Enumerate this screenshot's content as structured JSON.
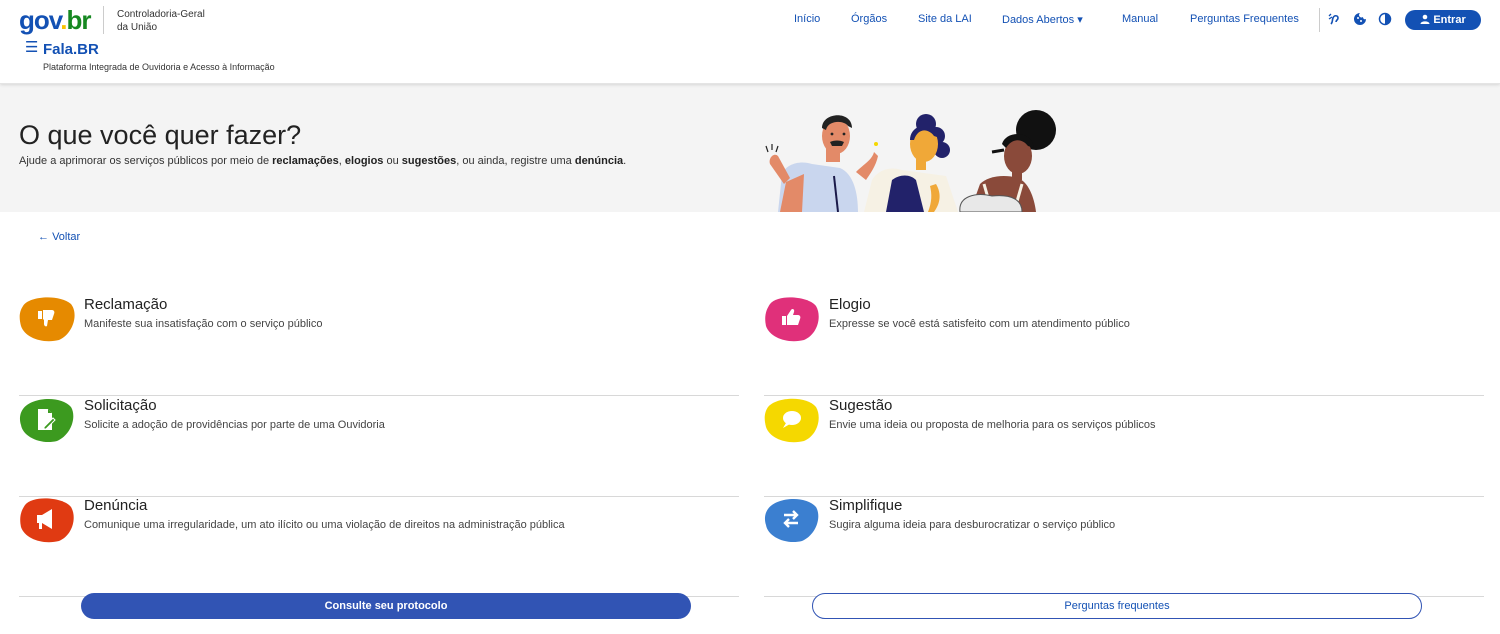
{
  "header": {
    "logo": {
      "g": "gov",
      "dot": ".",
      "br": "br"
    },
    "org_name_line1": "Controladoria-Geral",
    "org_name_line2": "da União",
    "menu_icon": "☰",
    "app_title": "Fala.BR",
    "app_subtitle": "Plataforma Integrada de Ouvidoria e Acesso à Informação",
    "nav": [
      {
        "label": "Início"
      },
      {
        "label": "Órgãos"
      },
      {
        "label": "Site da LAI"
      },
      {
        "label": "Dados Abertos"
      },
      {
        "label": "Manual"
      },
      {
        "label": "Perguntas Frequentes"
      }
    ],
    "dropdown_caret": "▾",
    "tools": [
      "accessibility-icon",
      "cookie-icon",
      "contrast-icon"
    ],
    "login_label": "Entrar"
  },
  "hero": {
    "title": "O que você quer fazer?",
    "desc_parts": {
      "p1": "Ajude a aprimorar os serviços públicos por meio de ",
      "b1": "reclamações",
      "p2": ", ",
      "b2": "elogios",
      "p3": " ou ",
      "b3": "sugestões",
      "p4": ", ou ainda, registre uma ",
      "b4": "denúncia",
      "p5": "."
    }
  },
  "back_label": "Voltar",
  "cards": [
    {
      "title": "Reclamação",
      "desc": "Manifeste sua insatisfação com o serviço público",
      "color": "#e68a00",
      "icon": "thumbs-down-icon"
    },
    {
      "title": "Elogio",
      "desc": "Expresse se você está satisfeito com um atendimento público",
      "color": "#e0307a",
      "icon": "thumbs-up-icon"
    },
    {
      "title": "Solicitação",
      "desc": "Solicite a adoção de providências por parte de uma Ouvidoria",
      "color": "#3c9a1f",
      "icon": "document-edit-icon"
    },
    {
      "title": "Sugestão",
      "desc": "Envie uma ideia ou proposta de melhoria para os serviços públicos",
      "color": "#f5d800",
      "icon": "chat-bubble-icon"
    },
    {
      "title": "Denúncia",
      "desc": "Comunique uma irregularidade, um ato ilícito ou uma violação de direitos na administração pública",
      "color": "#e03a12",
      "icon": "megaphone-icon"
    },
    {
      "title": "Simplifique",
      "desc": "Sugira alguma ideia para desburocratizar o serviço público",
      "color": "#3b7fd0",
      "icon": "arrows-exchange-icon"
    }
  ],
  "buttons": {
    "protocol": "Consulte seu protocolo",
    "faq": "Perguntas frequentes"
  }
}
